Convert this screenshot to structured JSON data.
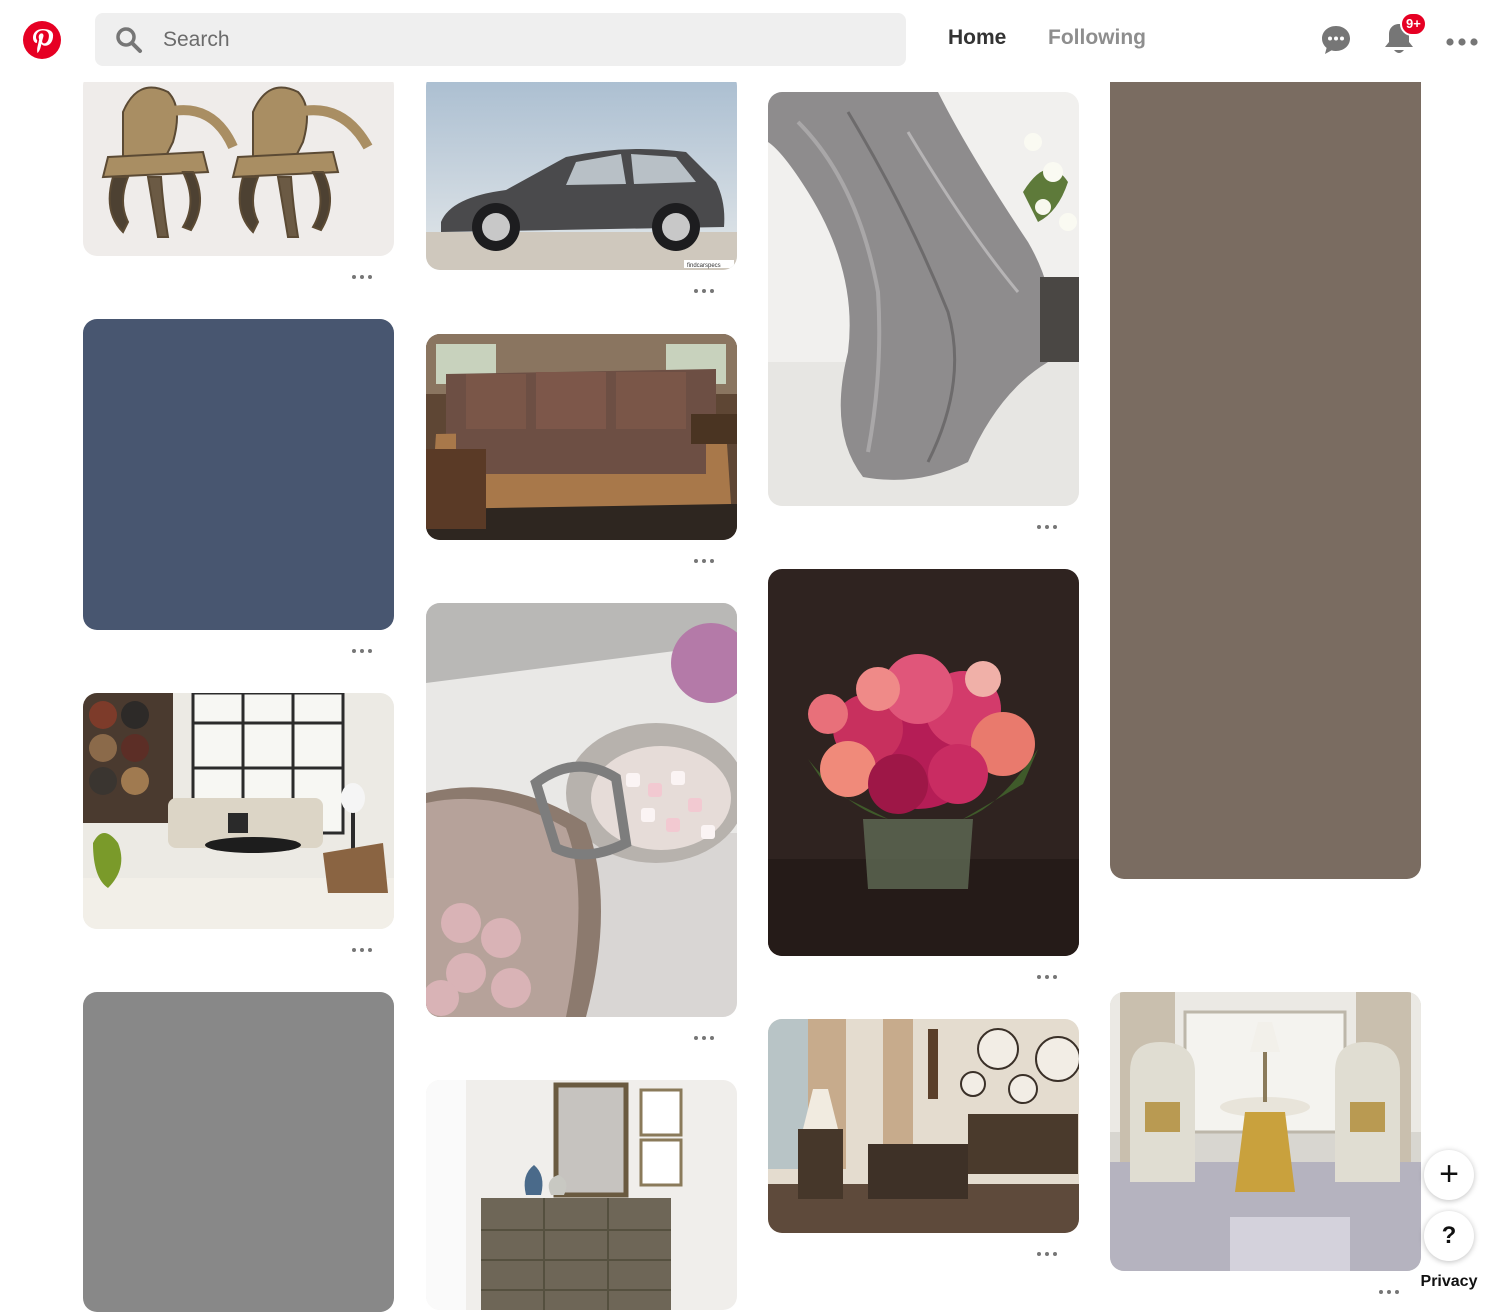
{
  "header": {
    "logo_icon": "pinterest-logo-icon",
    "search": {
      "placeholder": "Search",
      "value": "",
      "icon": "search-icon"
    },
    "nav": [
      {
        "label": "Home",
        "active": true
      },
      {
        "label": "Following",
        "active": false
      }
    ],
    "messages_icon": "chat-bubble-icon",
    "notifications_icon": "bell-icon",
    "notifications_badge": "9+",
    "more_icon": "ellipsis-icon"
  },
  "pins": [
    {
      "name": "ornate-gilded-chairs",
      "color": "#efecea"
    },
    {
      "name": "grey-hatchback-car",
      "color": "#c9d3dc",
      "watermark": "findcarspecs"
    },
    {
      "name": "silver-horse-head-sculpture",
      "color": "#f1f0ee"
    },
    {
      "name": "taupe-color-swatch",
      "color": "#7a6c61"
    },
    {
      "name": "navy-color-swatch",
      "color": "#485670"
    },
    {
      "name": "plaid-sofa",
      "color": "#6b4a36"
    },
    {
      "name": "pink-peony-bouquet",
      "color": "#2f2320"
    },
    {
      "name": "modern-living-room",
      "color": "#eceae4"
    },
    {
      "name": "silver-bowl-marshmallows",
      "color": "#cfc9c7"
    },
    {
      "name": "grey-color-swatch",
      "color": "#888888"
    },
    {
      "name": "rustic-living-room",
      "color": "#d9cbb8"
    },
    {
      "name": "sitting-room-armchairs",
      "color": "#d8d6d0"
    },
    {
      "name": "dresser-with-mirror",
      "color": "#f0eeeb"
    }
  ],
  "pin_menu_icon": "ellipsis-icon",
  "actions": {
    "add_icon": "plus-icon",
    "help_label": "?",
    "privacy_label": "Privacy"
  },
  "colors": {
    "brand": "#e60023",
    "search_bg": "#efefef",
    "text_active": "#333333",
    "text_muted": "#8e8e8e"
  }
}
